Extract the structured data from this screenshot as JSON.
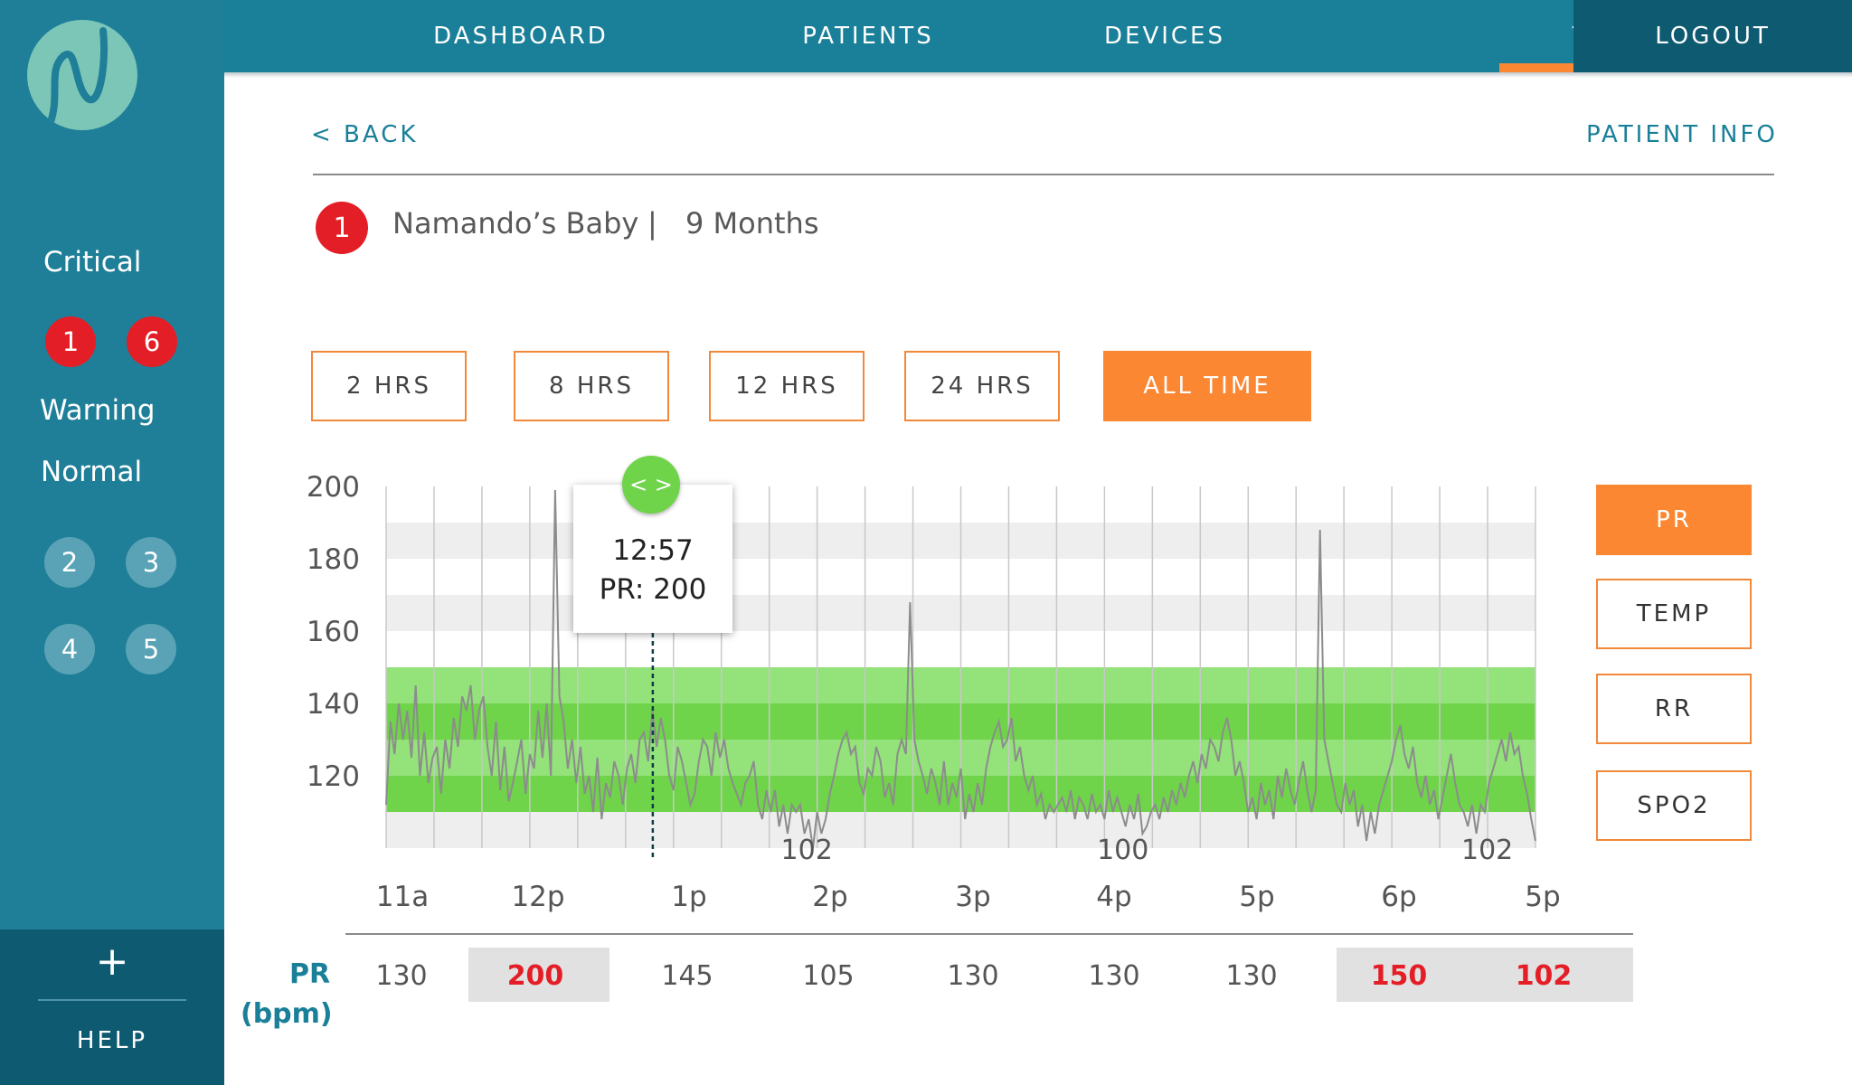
{
  "nav": {
    "items": [
      "DASHBOARD",
      "PATIENTS",
      "DEVICES",
      "TRENDS"
    ],
    "active": "TRENDS",
    "logout": "LOGOUT"
  },
  "sidebar": {
    "critical_label": "Critical",
    "critical_ids": [
      "1",
      "6"
    ],
    "warning_label": "Warning",
    "normal_label": "Normal",
    "normal_ids": [
      "2",
      "3",
      "4",
      "5"
    ],
    "add_label": "+",
    "help_label": "HELP"
  },
  "header": {
    "back_label": "< BACK",
    "patient_info_label": "PATIENT INFO"
  },
  "patient": {
    "id": "1",
    "name": "Namando’s Baby",
    "separator": "|",
    "age": "9 Months"
  },
  "time_ranges": {
    "items": [
      "2 HRS",
      "8 HRS",
      "12 HRS",
      "24 HRS",
      "ALL TIME"
    ],
    "active": "ALL TIME"
  },
  "metrics": {
    "items": [
      "PR",
      "TEMP",
      "RR",
      "SPO2"
    ],
    "active": "PR"
  },
  "tooltip": {
    "handle_label": "< >",
    "time": "12:57",
    "value": "PR: 200"
  },
  "colors": {
    "primary": "#1a7f98",
    "sidebar_dark": "#0e5a71",
    "accent": "#fc8732",
    "critical": "#e41e26",
    "normal_band": "#6fd44a",
    "trace": "#8c8c8c"
  },
  "summary": {
    "label_line1": "PR",
    "label_line2": "(bpm)",
    "values": [
      {
        "value": "130",
        "highlight": false
      },
      {
        "value": "200",
        "highlight": true
      },
      {
        "value": "145",
        "highlight": false
      },
      {
        "value": "105",
        "highlight": false
      },
      {
        "value": "130",
        "highlight": false
      },
      {
        "value": "130",
        "highlight": false
      },
      {
        "value": "130",
        "highlight": false
      },
      {
        "value": "150",
        "highlight": true
      },
      {
        "value": "102",
        "highlight": true
      }
    ]
  },
  "chart_data": {
    "type": "line",
    "y_ticks": [
      200,
      180,
      160,
      140,
      120
    ],
    "ylim": [
      100,
      200
    ],
    "x_ticks": [
      "11a",
      "12p",
      "1p",
      "2p",
      "3p",
      "4p",
      "5p",
      "6p",
      "5p"
    ],
    "normal_range": [
      110,
      150
    ],
    "inner_range": [
      120,
      140
    ],
    "annotations": [
      {
        "text": "102",
        "x_frac": 0.366,
        "y": 102
      },
      {
        "text": "100",
        "x_frac": 0.641,
        "y": 100
      },
      {
        "text": "102",
        "x_frac": 0.958,
        "y": 102
      }
    ],
    "cursor": {
      "x_frac": 0.232,
      "time": "12:57",
      "value": 200
    },
    "series": [
      {
        "values": [
          112,
          135,
          126,
          140,
          130,
          138,
          125,
          145,
          120,
          132,
          118,
          125,
          128,
          115,
          130,
          122,
          136,
          128,
          142,
          138,
          145,
          130,
          138,
          142,
          128,
          120,
          135,
          116,
          128,
          113,
          118,
          124,
          130,
          115,
          126,
          122,
          138,
          125,
          140,
          120,
          199,
          142,
          135,
          122,
          130,
          118,
          128,
          115,
          120,
          110,
          125,
          108,
          118,
          114,
          124,
          120,
          112,
          122,
          126,
          118,
          130,
          132,
          124,
          138,
          128,
          136,
          130,
          120,
          116,
          128,
          124,
          118,
          112,
          115,
          124,
          130,
          128,
          120,
          132,
          125,
          130,
          122,
          118,
          115,
          112,
          118,
          120,
          124,
          112,
          108,
          116,
          110,
          116,
          106,
          112,
          104,
          112,
          110,
          112,
          104,
          108,
          100,
          110,
          104,
          108,
          115,
          120,
          126,
          130,
          132,
          126,
          128,
          118,
          115,
          122,
          120,
          128,
          124,
          114,
          118,
          112,
          126,
          130,
          126,
          168,
          130,
          124,
          120,
          115,
          122,
          118,
          112,
          124,
          112,
          118,
          114,
          122,
          108,
          115,
          110,
          118,
          112,
          122,
          128,
          132,
          135,
          128,
          130,
          136,
          124,
          128,
          120,
          116,
          120,
          112,
          115,
          108,
          112,
          110,
          112,
          114,
          110,
          116,
          108,
          114,
          112,
          108,
          115,
          110,
          112,
          108,
          116,
          110,
          114,
          110,
          106,
          112,
          108,
          115,
          104,
          106,
          110,
          112,
          108,
          114,
          110,
          116,
          112,
          118,
          114,
          120,
          124,
          118,
          126,
          122,
          130,
          128,
          124,
          132,
          136,
          130,
          120,
          124,
          118,
          110,
          114,
          108,
          118,
          112,
          116,
          108,
          120,
          114,
          122,
          116,
          112,
          118,
          124,
          116,
          110,
          116,
          188,
          130,
          124,
          118,
          112,
          110,
          118,
          112,
          116,
          106,
          112,
          102,
          110,
          104,
          112,
          116,
          120,
          124,
          130,
          134,
          126,
          122,
          128,
          118,
          114,
          120,
          112,
          116,
          108,
          114,
          120,
          126,
          118,
          112,
          110,
          106,
          112,
          104,
          112,
          110,
          118,
          122,
          126,
          130,
          124,
          132,
          126,
          128,
          120,
          115,
          108,
          102
        ]
      }
    ]
  }
}
